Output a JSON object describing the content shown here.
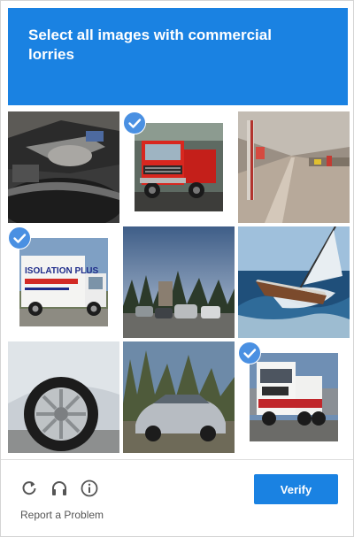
{
  "header": {
    "instruction": "Select all images with commercial lorries"
  },
  "tiles": [
    {
      "subject": "car wheel and mechanical parts close-up",
      "selected": false
    },
    {
      "subject": "red commercial truck cab",
      "selected": true
    },
    {
      "subject": "underground parking garage",
      "selected": false
    },
    {
      "subject": "white box truck with Insulation Plus signage",
      "selected": true,
      "label": "ISOLATION PLUS"
    },
    {
      "subject": "parking lot with cars and trees",
      "selected": false
    },
    {
      "subject": "sailboat heeling in rough sea",
      "selected": false
    },
    {
      "subject": "silver car wheel close-up",
      "selected": false
    },
    {
      "subject": "silver sedan parked in driveway",
      "selected": false
    },
    {
      "subject": "white and red semi truck",
      "selected": true
    }
  ],
  "footer": {
    "reload_icon": "reload-icon",
    "audio_icon": "headphones-icon",
    "info_icon": "info-icon",
    "report_label": "Report a Problem",
    "verify_label": "Verify"
  },
  "colors": {
    "accent": "#1a82e2",
    "check": "#4a90e2"
  }
}
